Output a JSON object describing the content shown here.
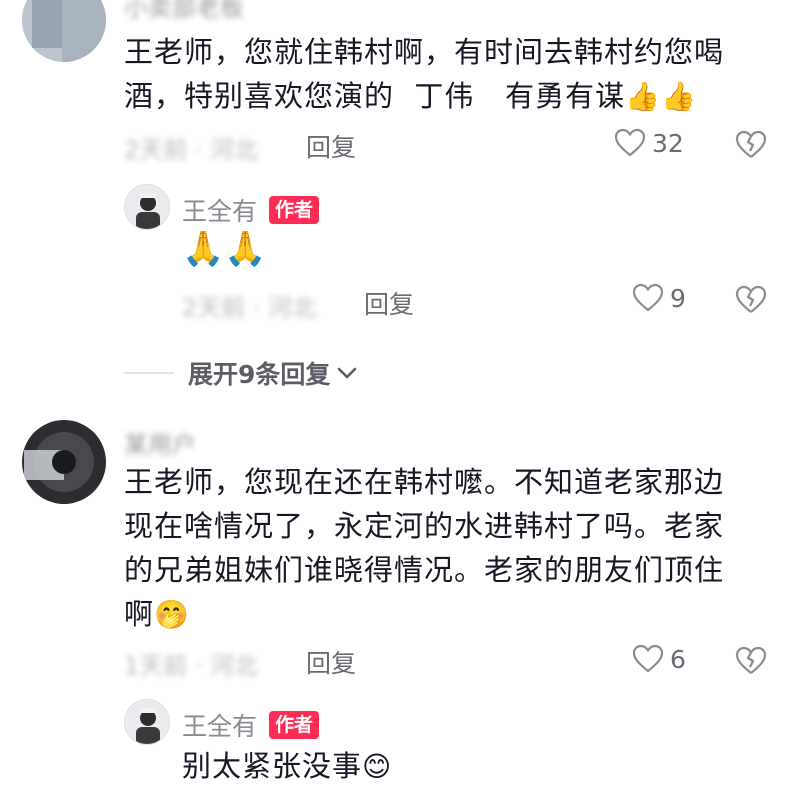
{
  "comments": [
    {
      "username": "小卖部老板",
      "text": "王老师，您就住韩村啊，有时间去韩村约您喝酒，特别喜欢您演的 丁伟 有勇有谋",
      "line1": "王老师，您就住韩村啊，有时间去韩村约您喝",
      "line2": "酒，特别喜欢您演的  丁伟   有勇有谋",
      "emojis": "👍👍",
      "meta": "2天前 · 河北",
      "reply_label": "回复",
      "likes": "32",
      "author_reply": {
        "name": "王全有",
        "badge": "作者",
        "text": "🙏🙏",
        "meta": "2天前 · 河北",
        "reply_label": "回复",
        "likes": "9"
      }
    },
    {
      "username": "某用户",
      "text": "王老师，您现在还在韩村嚒。不知道老家那边现在啥情况了，永定河的水进韩村了吗。老家的兄弟姐妹们谁晓得情况。老家的朋友们顶住啊",
      "line1": "王老师，您现在还在韩村嚒。不知道老家那边",
      "line2": "现在啥情况了，永定河的水进韩村了吗。老家",
      "line3": "的兄弟姐妹们谁晓得情况。老家的朋友们顶住",
      "line4": "啊",
      "emoji_end": "🤭",
      "meta": "1天前 · 河北",
      "reply_label": "回复",
      "likes": "6",
      "author_reply": {
        "name": "王全有",
        "badge": "作者",
        "text": "别太紧张没事",
        "emoji_end": "😊"
      }
    }
  ],
  "expand_replies": {
    "label": "展开9条回复"
  },
  "colors": {
    "badge": "#fe2c55",
    "text": "#161823",
    "muted": "#6b6b73"
  },
  "icons": [
    "heart-icon",
    "broken-heart-icon",
    "chevron-down-icon"
  ]
}
